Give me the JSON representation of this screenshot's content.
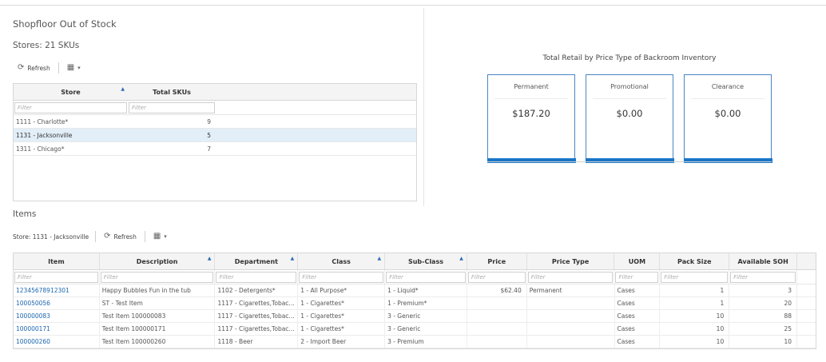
{
  "page": {
    "title": "Shopfloor Out of Stock"
  },
  "stores_section": {
    "title": "Stores: 21 SKUs",
    "refresh_label": "Refresh",
    "columns": [
      "Store",
      "Total SKUs"
    ],
    "filter_placeholder": "Filter",
    "rows": [
      {
        "store": "1111 - Charlotte*",
        "skus": "9"
      },
      {
        "store": "1131 - Jacksonville",
        "skus": "5",
        "selected": true
      },
      {
        "store": "1311 - Chicago*",
        "skus": "7"
      }
    ]
  },
  "retail_panel": {
    "title": "Total Retail by Price Type of Backroom Inventory",
    "cards": [
      {
        "label": "Permanent",
        "value": "$187.20"
      },
      {
        "label": "Promotional",
        "value": "$0.00"
      },
      {
        "label": "Clearance",
        "value": "$0.00"
      }
    ],
    "accent_color": "#1a76c8"
  },
  "items_section": {
    "title": "Items",
    "store_label": "Store: 1131 - Jacksonville",
    "refresh_label": "Refresh",
    "filter_placeholder": "Filter",
    "columns": [
      "Item",
      "Description",
      "Department",
      "Class",
      "Sub-Class",
      "Price",
      "Price Type",
      "UOM",
      "Pack Size",
      "Available SOH"
    ],
    "rows": [
      [
        "12345678912301",
        "Happy Bubbles Fun in the tub",
        "1102 - Detergents*",
        "1 - All Purpose*",
        "1 - Liquid*",
        "$62.40",
        "Permanent",
        "Cases",
        "1",
        "3"
      ],
      [
        "100050056",
        "ST - Test Item",
        "1117 - Cigarettes,Tobacc...",
        "1 - Cigarettes*",
        "1 - Premium*",
        "",
        "",
        "Cases",
        "1",
        "20"
      ],
      [
        "100000083",
        "Test Item 100000083",
        "1117 - Cigarettes,Tobacc...",
        "1 - Cigarettes*",
        "3 - Generic",
        "",
        "",
        "Cases",
        "10",
        "88"
      ],
      [
        "100000171",
        "Test Item 100000171",
        "1117 - Cigarettes,Tobacc...",
        "1 - Cigarettes*",
        "3 - Generic",
        "",
        "",
        "Cases",
        "10",
        "25"
      ],
      [
        "100000260",
        "Test Item 100000260",
        "1118 - Beer",
        "2 - Import Beer",
        "3 - Premium",
        "",
        "",
        "Cases",
        "10",
        "10"
      ]
    ]
  }
}
